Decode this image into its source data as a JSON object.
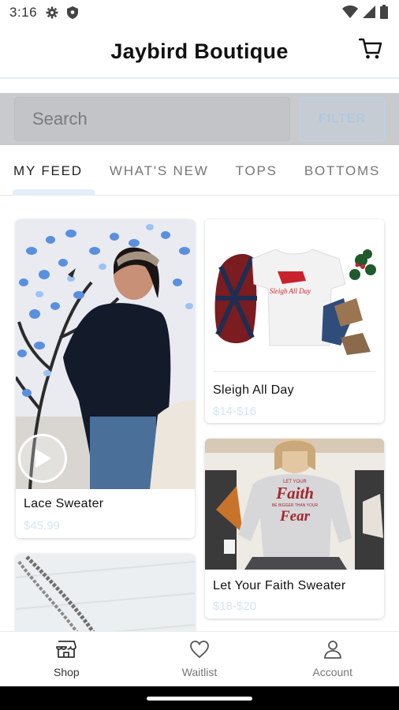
{
  "status_bar": {
    "time": "3:16",
    "icons": [
      "gear-icon",
      "shield-icon",
      "wifi-icon",
      "signal-icon",
      "battery-icon"
    ]
  },
  "header": {
    "title": "Jaybird Boutique",
    "cart_icon": "cart-icon"
  },
  "search": {
    "placeholder": "Search",
    "filter_label": "FILTER"
  },
  "tabs": [
    {
      "label": "MY FEED",
      "active": true
    },
    {
      "label": "WHAT'S NEW",
      "active": false
    },
    {
      "label": "TOPS",
      "active": false
    },
    {
      "label": "BOTTOMS",
      "active": false
    }
  ],
  "products": [
    {
      "name": "Lace Sweater",
      "price": "$45.99",
      "has_video": true
    },
    {
      "name": "Sleigh All Day",
      "price": "$14-$16",
      "has_video": false
    },
    {
      "name": "Let Your Faith Sweater",
      "price": "$18-$20",
      "has_video": false
    },
    {
      "name": "",
      "price": "",
      "has_video": false
    }
  ],
  "product_art_text": {
    "sleigh_shirt": "Sleigh All Day",
    "faith_line1": "LET YOUR",
    "faith_line2": "Faith",
    "faith_line3": "BE BIGGER THAN YOUR",
    "faith_line4": "Fear"
  },
  "bottom_nav": [
    {
      "label": "Shop",
      "icon": "store-icon",
      "active": true
    },
    {
      "label": "Waitlist",
      "icon": "heart-icon",
      "active": false
    },
    {
      "label": "Account",
      "icon": "person-icon",
      "active": false
    }
  ],
  "colors": {
    "accent_light": "#e3eef8",
    "price_text": "#d6e6f5",
    "search_overlay": "#c9cacd"
  }
}
